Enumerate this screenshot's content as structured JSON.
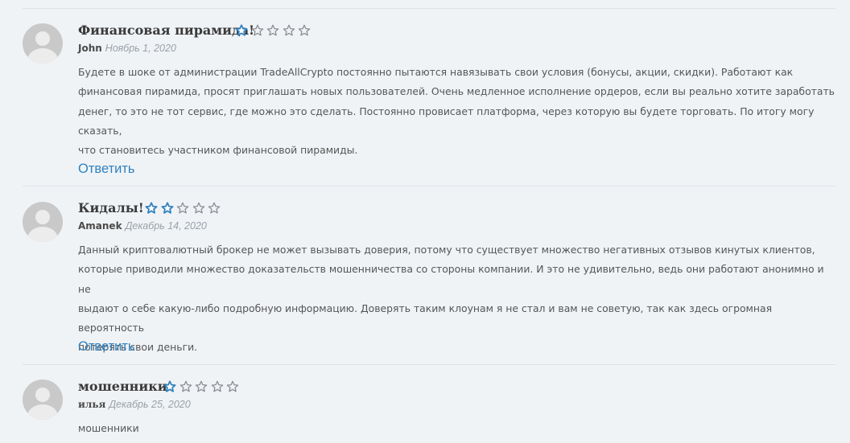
{
  "reviews": [
    {
      "title": "Финансовая пирамида!",
      "rating": 1,
      "max_rating": 5,
      "author": "John",
      "date": "Ноябрь 1, 2020",
      "lines": [
        "Будете в шоке от администрации TradeAllCrypto постоянно пытаются навязывать свои условия (бонусы, акции, скидки). Работают как",
        "финансовая пирамида, просят приглашать новых пользователей. Очень медленное исполнение ордеров, если вы реально хотите заработать",
        "денег, то это не тот сервис, где можно это сделать. Постоянно провисает платформа, через которую вы будете торговать. По итогу могу сказать,",
        "что становитесь участником финансовой пирамиды."
      ],
      "reply_label": "Ответить"
    },
    {
      "title": "Кидалы!",
      "rating": 2,
      "max_rating": 5,
      "author": "Amanek",
      "date": "Декабрь 14, 2020",
      "lines": [
        "Данный криптовалютный брокер не может вызывать доверия, потому что существует множество негативных отзывов кинутых клиентов,",
        "которые приводили множество доказательств мошенничества со стороны компании. И это не удивительно, ведь они работают анонимно и не",
        "выдают о себе какую-либо подробную информацию. Доверять таким клоунам я не стал и вам не советую, так как здесь огромная вероятность",
        "потерять свои деньги."
      ],
      "reply_label": "Ответить"
    },
    {
      "title": "мошенники",
      "rating": 1,
      "max_rating": 5,
      "author": "илья",
      "date": "Декабрь 25, 2020",
      "lines": [
        "мошенники"
      ]
    }
  ],
  "colors": {
    "star_filled": "#2f82c0",
    "star_empty": "#8a8f94",
    "link": "#2f82c0"
  },
  "icons": {
    "avatar": "user-avatar-placeholder",
    "star": "star-icon"
  }
}
